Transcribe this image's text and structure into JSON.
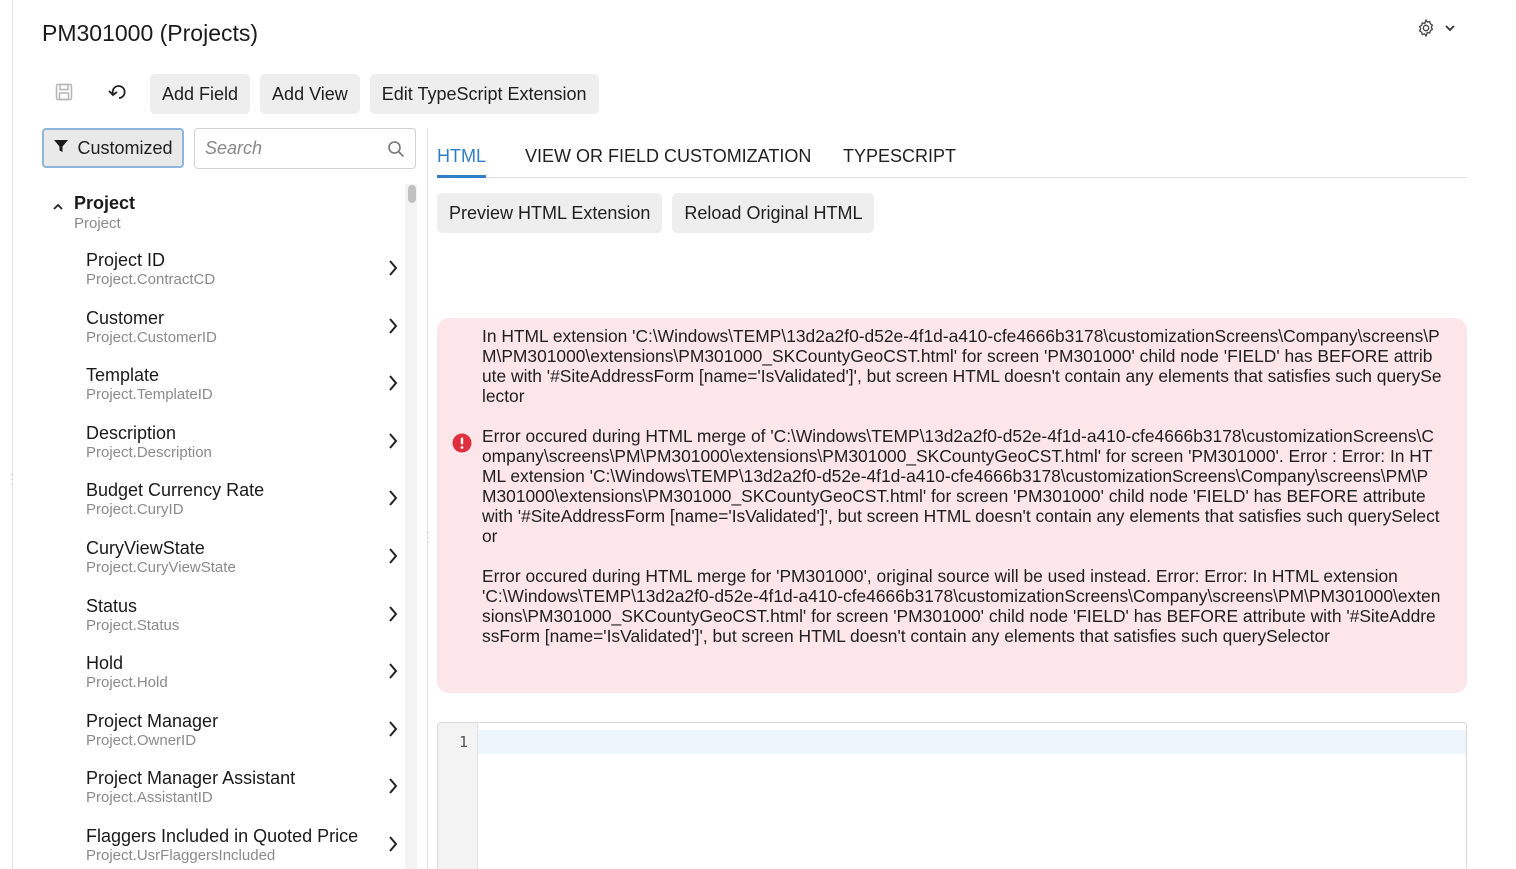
{
  "page": {
    "title": "PM301000 (Projects)"
  },
  "toolbar": {
    "add_field": "Add Field",
    "add_view": "Add View",
    "edit_ts": "Edit TypeScript Extension"
  },
  "filter": {
    "label": "Customized"
  },
  "search": {
    "placeholder": "Search"
  },
  "tree": {
    "root": {
      "label": "Project",
      "sub": "Project"
    },
    "items": [
      {
        "label": "Project ID",
        "sub": "Project.ContractCD"
      },
      {
        "label": "Customer",
        "sub": "Project.CustomerID"
      },
      {
        "label": "Template",
        "sub": "Project.TemplateID"
      },
      {
        "label": "Description",
        "sub": "Project.Description"
      },
      {
        "label": "Budget Currency Rate",
        "sub": "Project.CuryID"
      },
      {
        "label": "CuryViewState",
        "sub": "Project.CuryViewState"
      },
      {
        "label": "Status",
        "sub": "Project.Status"
      },
      {
        "label": "Hold",
        "sub": "Project.Hold"
      },
      {
        "label": "Project Manager",
        "sub": "Project.OwnerID"
      },
      {
        "label": "Project Manager Assistant",
        "sub": "Project.AssistantID"
      },
      {
        "label": "Flaggers Included in Quoted Price",
        "sub": "Project.UsrFlaggersIncluded"
      }
    ]
  },
  "tabs": [
    {
      "label": "HTML"
    },
    {
      "label": "VIEW OR FIELD CUSTOMIZATION"
    },
    {
      "label": "TYPESCRIPT"
    }
  ],
  "actions": {
    "preview": "Preview HTML Extension",
    "reload": "Reload Original HTML"
  },
  "errors": [
    "In HTML extension 'C:\\Windows\\TEMP\\13d2a2f0-d52e-4f1d-a410-cfe4666b3178\\customizationScreens\\Company\\screens\\PM\\PM301000\\extensions\\PM301000_SKCountyGeoCST.html' for screen 'PM301000' child node 'FIELD' has BEFORE attribute with '#SiteAddressForm [name='IsValidated']', but screen HTML doesn't contain any elements that satisfies such querySelector",
    "Error occured during HTML merge of 'C:\\Windows\\TEMP\\13d2a2f0-d52e-4f1d-a410-cfe4666b3178\\customizationScreens\\Company\\screens\\PM\\PM301000\\extensions\\PM301000_SKCountyGeoCST.html' for screen 'PM301000'. Error : Error: In HTML extension 'C:\\Windows\\TEMP\\13d2a2f0-d52e-4f1d-a410-cfe4666b3178\\customizationScreens\\Company\\screens\\PM\\PM301000\\extensions\\PM301000_SKCountyGeoCST.html' for screen 'PM301000' child node 'FIELD' has BEFORE attribute with '#SiteAddressForm [name='IsValidated']', but screen HTML doesn't contain any elements that satisfies such querySelector",
    "Error occured during HTML merge for 'PM301000', original source will be used instead. Error: Error: In HTML extension 'C:\\Windows\\TEMP\\13d2a2f0-d52e-4f1d-a410-cfe4666b3178\\customizationScreens\\Company\\screens\\PM\\PM301000\\extensions\\PM301000_SKCountyGeoCST.html' for screen 'PM301000' child node 'FIELD' has BEFORE attribute with '#SiteAddressForm [name='IsValidated']', but screen HTML doesn't contain any elements that satisfies such querySelector"
  ],
  "editor": {
    "line_number": "1"
  },
  "icons": {
    "save": "save-icon",
    "undo": "undo-icon",
    "filter": "filter-icon",
    "search": "search-icon",
    "settings": "gear-icon",
    "chevron_down": "chevron-down-icon",
    "chevron_up": "chevron-up-icon",
    "chevron_right": "chevron-right-icon",
    "error": "error-icon"
  },
  "colors": {
    "accent": "#2f7ec7",
    "error_bg": "#fde6e9",
    "error_icon": "#e0303f",
    "button_bg": "#eeeeee"
  }
}
